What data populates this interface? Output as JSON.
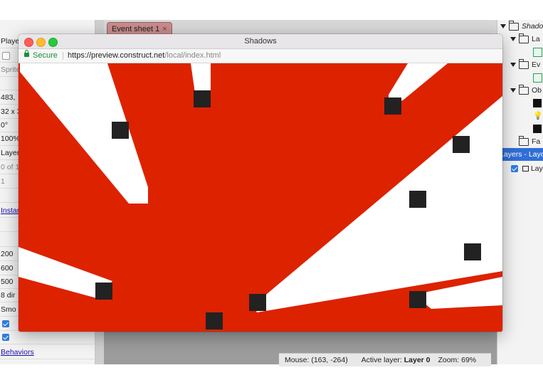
{
  "editor": {
    "left_panel": {
      "rows": [
        {
          "text": "Playe",
          "style": "normal"
        },
        {
          "text": "",
          "style": "checkbox-empty"
        },
        {
          "text": "Sprite",
          "style": "muted"
        },
        {
          "text": "",
          "style": "blank"
        },
        {
          "text": "483,",
          "style": "normal"
        },
        {
          "text": "32 x 3",
          "style": "normal"
        },
        {
          "text": "0°",
          "style": "normal"
        },
        {
          "text": "100%",
          "style": "normal"
        },
        {
          "text": "Layer",
          "style": "normal"
        },
        {
          "text": "0 of 1",
          "style": "muted"
        },
        {
          "text": "1",
          "style": "muted"
        },
        {
          "text": "",
          "style": "blank"
        },
        {
          "text": "Instan",
          "style": "link"
        },
        {
          "text": "",
          "style": "blank"
        },
        {
          "text": "",
          "style": "blank"
        },
        {
          "text": "200",
          "style": "normal"
        },
        {
          "text": "600",
          "style": "normal"
        },
        {
          "text": "500",
          "style": "normal"
        },
        {
          "text": "8 dir",
          "style": "normal"
        },
        {
          "text": "Smo",
          "style": "normal"
        },
        {
          "text": "",
          "style": "checkbox"
        },
        {
          "text": "",
          "style": "checkbox"
        },
        {
          "text": "Behaviors",
          "style": "link"
        }
      ]
    },
    "tabs": [
      {
        "label": "Event sheet 1",
        "close": "×"
      }
    ],
    "project_tree": {
      "items": [
        {
          "label": "Shado",
          "icon": "folder-icon",
          "expanded": true
        },
        {
          "label": "La",
          "icon": "folder-icon",
          "expanded": true
        },
        {
          "label": "",
          "icon": "layout-icon"
        },
        {
          "label": "Ev",
          "icon": "folder-icon",
          "expanded": true
        },
        {
          "label": "",
          "icon": "event-sheet-icon"
        },
        {
          "label": "Ob",
          "icon": "folder-icon",
          "expanded": true
        },
        {
          "label": "",
          "icon": "sprite-object-icon"
        },
        {
          "label": "",
          "icon": "light-object-icon"
        },
        {
          "label": "",
          "icon": "sprite-object-icon"
        },
        {
          "label": "Fa",
          "icon": "folder-icon",
          "expanded": false
        }
      ]
    },
    "layers_panel": {
      "header": "Layers - Layo",
      "items": [
        {
          "label": "Lay",
          "checked": true,
          "locked": true
        }
      ]
    },
    "status_bar": {
      "mouse": "Mouse: (163, -264)",
      "active_layer_label": "Active layer:",
      "active_layer_value": "Layer 0",
      "zoom": "Zoom: 69%"
    }
  },
  "browser": {
    "title": "Shadows",
    "secure_label": "Secure",
    "url_host": "https://preview.construct.net",
    "url_path": "/local/index.html",
    "viewport_color": "#dd2200",
    "shadow_color": "#ffffff",
    "box_color": "#222222"
  },
  "colors": {
    "selection_blue": "#2f6fd6",
    "tab_red": "#c98c8c",
    "secure_green": "#1a8f3a"
  }
}
